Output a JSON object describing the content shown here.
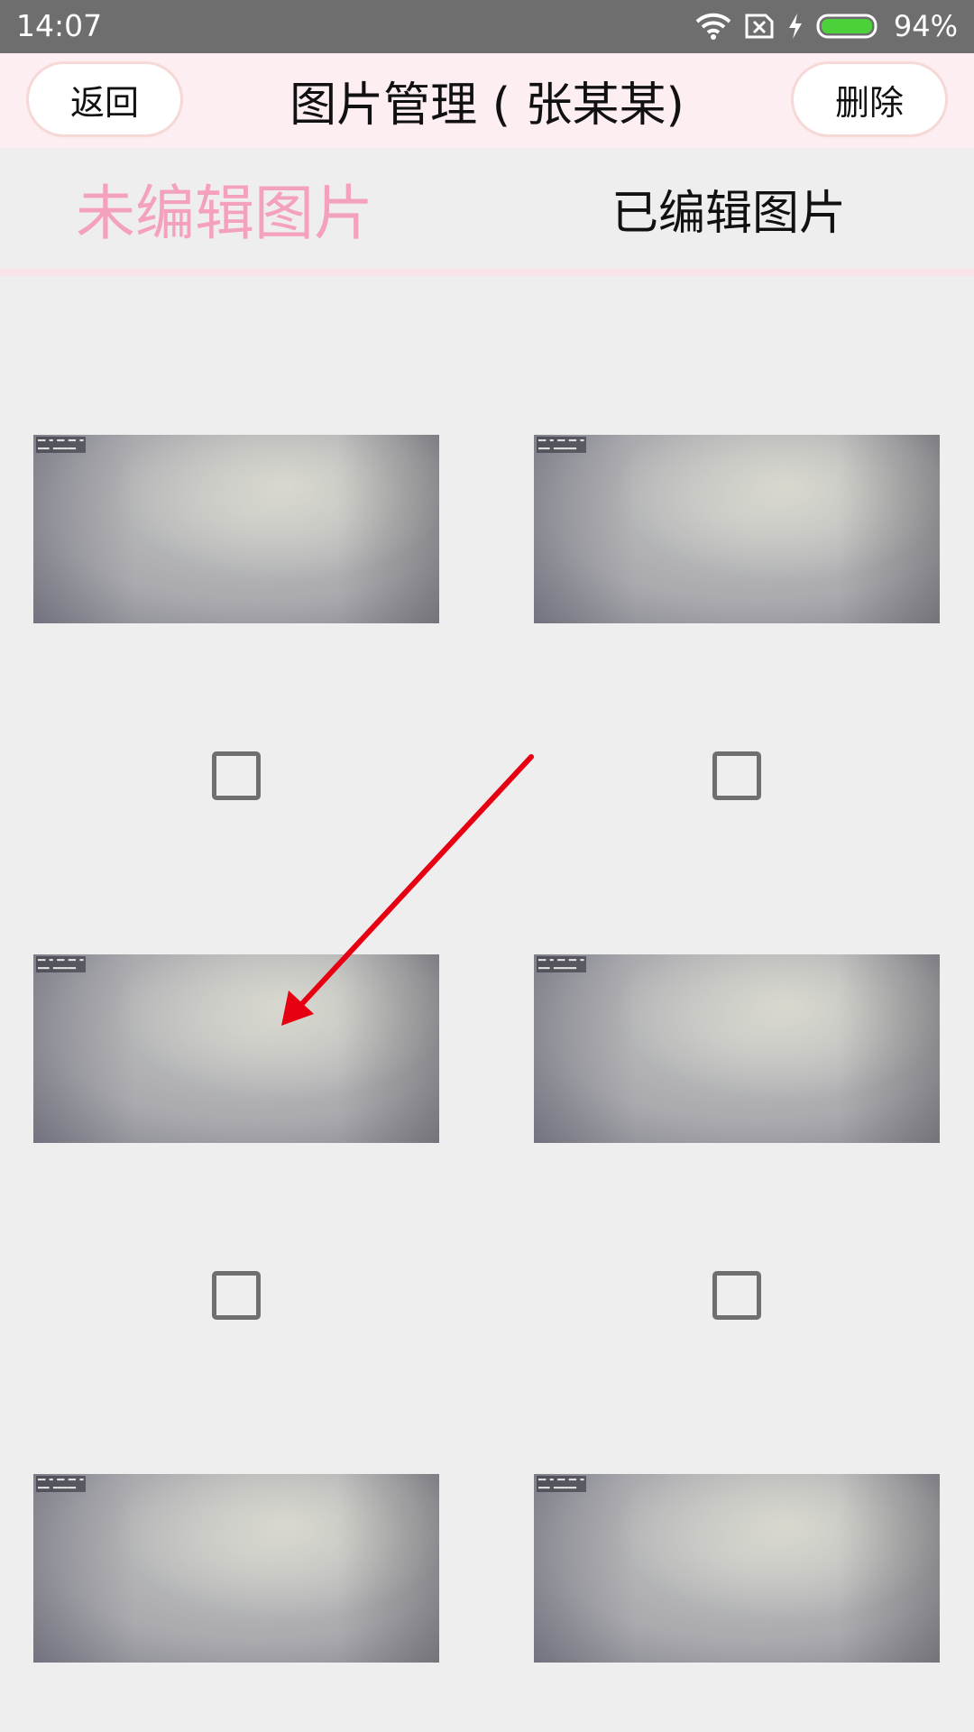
{
  "status_bar": {
    "time": "14:07",
    "battery_percent": "94%",
    "icons": [
      "wifi-icon",
      "no-sim-icon",
      "charging-icon",
      "battery-icon"
    ]
  },
  "header": {
    "back_label": "返回",
    "title": "图片管理 ( 张某某)",
    "delete_label": "删除"
  },
  "tabs": [
    {
      "label": "未编辑图片",
      "active": true
    },
    {
      "label": "已编辑图片",
      "active": false
    }
  ],
  "colors": {
    "header_bg": "#fdeef2",
    "active_tab": "#f4a1bd",
    "status_bar": "#6e6e6e",
    "annotation_arrow": "#e60012",
    "battery_green": "#4cd13a"
  },
  "photos": [
    {
      "checked": false
    },
    {
      "checked": false
    },
    {
      "checked": false
    },
    {
      "checked": false
    },
    {
      "checked": false
    },
    {
      "checked": false
    }
  ]
}
